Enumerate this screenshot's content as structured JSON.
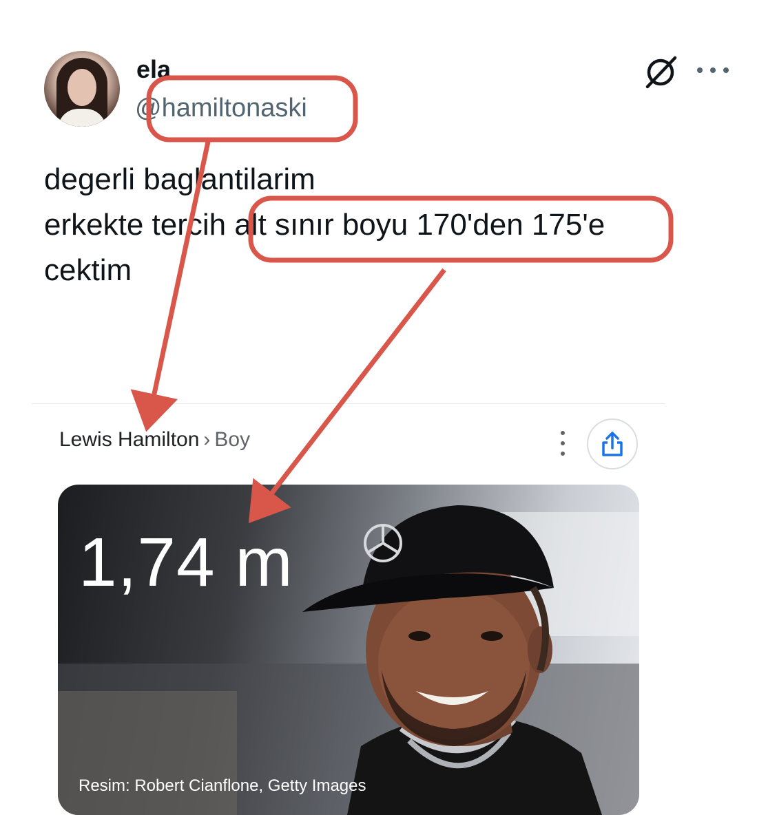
{
  "tweet": {
    "display_name": "ela",
    "handle": "@hamiltonaski",
    "text_lines": [
      "degerli baglantilarim",
      "erkekte tercih alt sınır boyu 170'den 175'e",
      "cektim"
    ]
  },
  "header_icons": {
    "grok": "grok-icon",
    "more": "more-options-icon"
  },
  "embedded_result": {
    "breadcrumb_parent": "Lewis Hamilton",
    "breadcrumb_separator": "›",
    "breadcrumb_leaf": "Boy",
    "height_value": "1,74 m",
    "photo_credit": "Resim: Robert Cianflone, Getty Images",
    "icons": [
      "more-vert-icon",
      "share-icon"
    ]
  },
  "annotation": {
    "color": "#d9574a",
    "highlights": [
      "handle",
      "tweet-phrase"
    ]
  }
}
